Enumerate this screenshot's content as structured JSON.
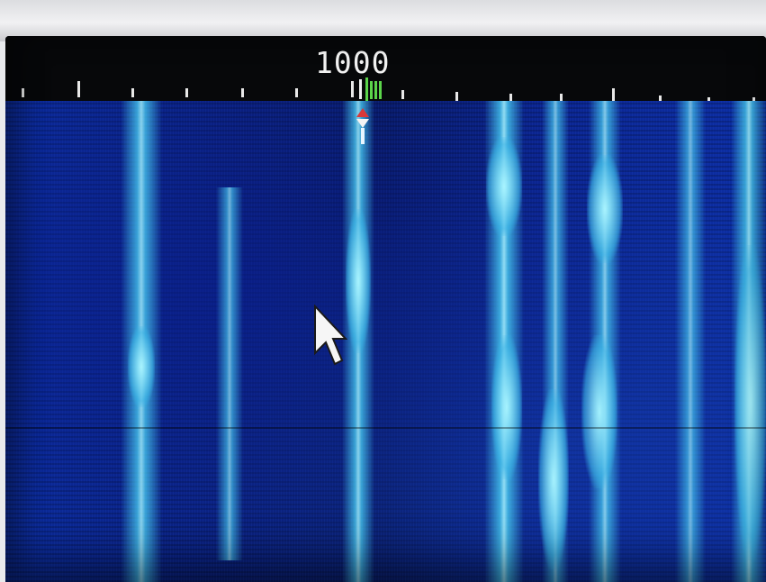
{
  "frequency_scale": {
    "center_label": "1000"
  },
  "waterfall": {
    "accent_colors": {
      "background": "#0a1f7c",
      "signal": "#5fd6f2",
      "signal_peak": "#c8f8ff",
      "marker_red": "#d8383a",
      "marker_green": "#5bd44a"
    }
  },
  "icons": {
    "mouse_pointer": "arrow-cursor-icon",
    "tuning_marker": "tuning-marker-icon",
    "filter_marker": "filter-marker-icon"
  }
}
